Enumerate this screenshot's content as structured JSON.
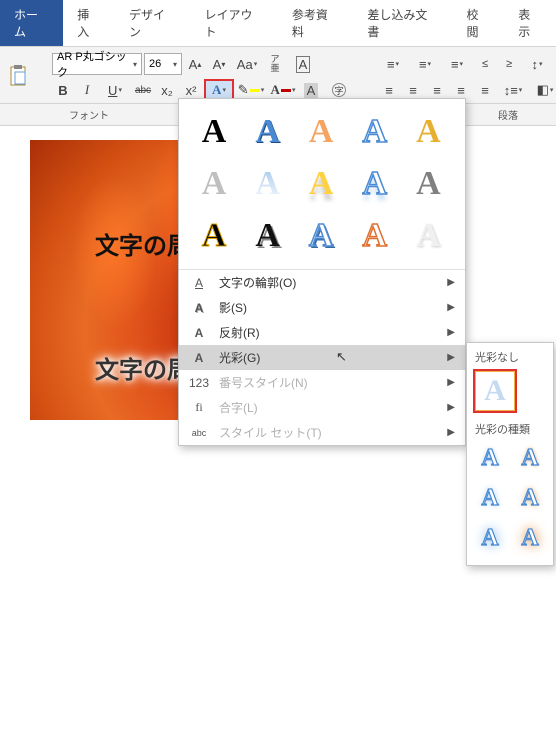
{
  "tabs": {
    "home": "ホーム",
    "insert": "挿入",
    "design": "デザイン",
    "layout": "レイアウト",
    "references": "参考資料",
    "mailings": "差し込み文書",
    "review": "校閲",
    "view": "表示"
  },
  "font": {
    "name": "AR P丸ゴシック",
    "size": "26"
  },
  "format_buttons": {
    "bold": "B",
    "italic": "I",
    "underline": "U",
    "strike": "abc",
    "sub": "x₂",
    "sup": "x²"
  },
  "group_labels": {
    "font": "フォント",
    "paragraph": "段落"
  },
  "fx_menu": {
    "outline": "文字の輪郭(O)",
    "shadow": "影(S)",
    "reflection": "反射(R)",
    "glow": "光彩(G)",
    "number_style": "番号スタイル(N)",
    "ligature": "合字(L)",
    "style_set": "スタイル セット(T)"
  },
  "glow_panel": {
    "none_header": "光彩なし",
    "variants_header": "光彩の種類",
    "letter": "A"
  },
  "fx_letter": "A",
  "doc": {
    "text1": "文字の周りが白くなる？",
    "text2": "文字の周りが白くなる？"
  }
}
